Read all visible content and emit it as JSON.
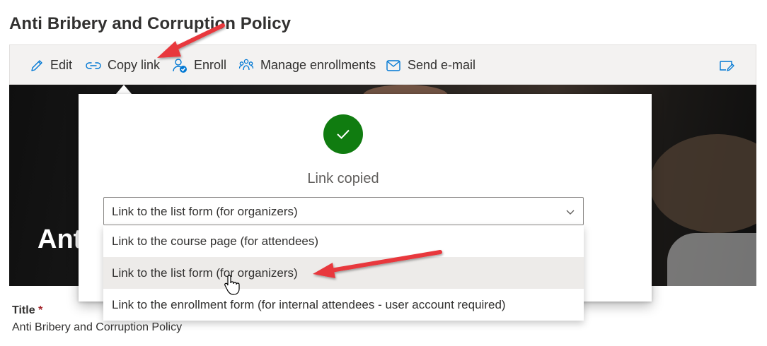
{
  "page": {
    "title": "Anti Bribery and Corruption Policy"
  },
  "toolbar": {
    "edit_label": "Edit",
    "copy_link_label": "Copy link",
    "enroll_label": "Enroll",
    "manage_enrollments_label": "Manage enrollments",
    "send_email_label": "Send e-mail"
  },
  "hero": {
    "title": "Anti"
  },
  "copy_dialog": {
    "status_text": "Link copied",
    "selected_value": "Link to the list form (for organizers)",
    "options": [
      "Link to the course page (for attendees)",
      "Link to the list form (for organizers)",
      "Link to the enrollment form (for internal attendees - user account required)"
    ]
  },
  "form": {
    "title_label": "Title",
    "required_marker": "*",
    "title_value": "Anti Bribery and Corruption Policy"
  },
  "colors": {
    "success": "#107c10",
    "annotation_arrow": "#e8383d",
    "required": "#a4262c",
    "command_bar_bg": "#f3f2f1"
  },
  "icons": {
    "edit": "pencil-icon",
    "copy_link": "link-icon",
    "enroll": "person-check-icon",
    "manage": "people-group-icon",
    "email": "envelope-icon",
    "right": "edit-note-icon",
    "success": "checkmark-icon",
    "dropdown": "chevron-down-icon"
  }
}
